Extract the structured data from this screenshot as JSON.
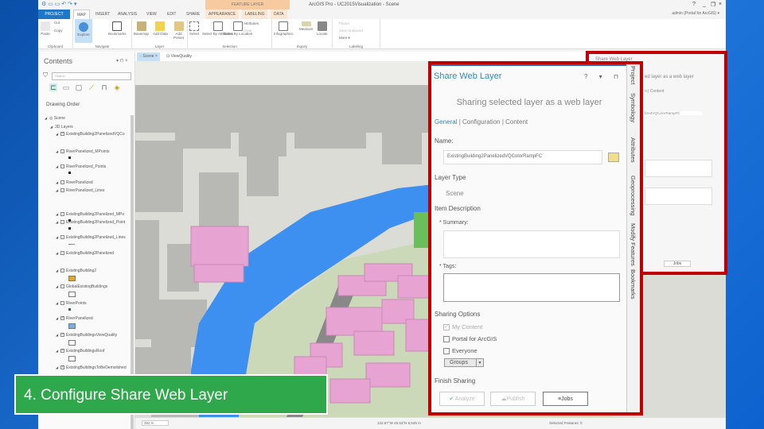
{
  "app": {
    "title": "ArcGIS Pro - UC2015Visualization - Scene",
    "contextual_tab": "FEATURE LAYER",
    "user": "admin (Portal for ArcGIS) ▾",
    "help": "?",
    "minimize": "_",
    "restore": "❐",
    "close": "×"
  },
  "ribbon_tabs": [
    "PROJECT",
    "MAP",
    "INSERT",
    "ANALYSIS",
    "VIEW",
    "EDIT",
    "SHARE",
    "APPEARANCE",
    "LABELING",
    "DATA"
  ],
  "ribbon_groups": [
    {
      "label": "Clipboard",
      "buttons": [
        "Paste",
        "Cut",
        "Copy"
      ]
    },
    {
      "label": "Navigate",
      "buttons": [
        "Explore",
        "Bookmarks"
      ]
    },
    {
      "label": "Layer",
      "buttons": [
        "Basemap",
        "Add Data",
        "Add Preset"
      ]
    },
    {
      "label": "Selection",
      "buttons": [
        "Select",
        "Select By Attributes",
        "Select By Location",
        "Attributes",
        "Clear"
      ]
    },
    {
      "label": "Inquiry",
      "buttons": [
        "Infographics",
        "Measure",
        "Locate"
      ]
    },
    {
      "label": "Labeling",
      "buttons": [
        "Pause",
        "View Unplaced",
        "More ▾"
      ]
    }
  ],
  "contents": {
    "title": "Contents",
    "pane_buttons": "▾ ⊓ ×",
    "search_placeholder": "Search",
    "drawing_order": "Drawing Order",
    "layers": [
      {
        "name": "Scene",
        "checked": null,
        "indent": 0,
        "symbol": "scene"
      },
      {
        "name": "3D Layers",
        "checked": null,
        "indent": 1,
        "symbol": "none"
      },
      {
        "name": "ExistingBuilding2PanelizedVQCo",
        "checked": true,
        "indent": 2,
        "symbol": "none"
      },
      {
        "name": "RiverPanelized_MPoints",
        "checked": false,
        "indent": 2,
        "symbol": "dot"
      },
      {
        "name": "RiverPanelized_Points",
        "checked": false,
        "indent": 2,
        "symbol": "dot"
      },
      {
        "name": "RiverPanelized",
        "checked": false,
        "indent": 2,
        "symbol": "none"
      },
      {
        "name": "RiverPanelized_Lines",
        "checked": false,
        "indent": 2,
        "symbol": "none"
      },
      {
        "name": "ExistingBuilding2Panelized_MPo",
        "checked": false,
        "indent": 2,
        "symbol": "dot"
      },
      {
        "name": "ExistingBuilding2Panelized_Point",
        "checked": false,
        "indent": 2,
        "symbol": "dot"
      },
      {
        "name": "ExistingBuilding2Panelized_Lines",
        "checked": false,
        "indent": 2,
        "symbol": "line"
      },
      {
        "name": "ExistingBuilding2Panelized",
        "checked": false,
        "indent": 2,
        "symbol": "none"
      },
      {
        "name": "ExistingBuilding2",
        "checked": false,
        "indent": 2,
        "symbol": "fill-orange"
      },
      {
        "name": "GlobalExistingBuildings",
        "checked": false,
        "indent": 2,
        "symbol": "fill-white"
      },
      {
        "name": "RiverPoints",
        "checked": false,
        "indent": 2,
        "symbol": "dot-green"
      },
      {
        "name": "RiverPanelized",
        "checked": true,
        "indent": 2,
        "symbol": "fill-blue"
      },
      {
        "name": "ExistingBuildingsViewQuality",
        "checked": true,
        "indent": 2,
        "symbol": "fill-white"
      },
      {
        "name": "ExistingBuildingsRoof",
        "checked": true,
        "indent": 2,
        "symbol": "fill-white"
      },
      {
        "name": "ExistingBuildingsToBeDemolished",
        "checked": true,
        "indent": 2,
        "symbol": "none"
      }
    ]
  },
  "map": {
    "tabs": [
      "Scene",
      "ViewQuality"
    ],
    "scale": "352 m",
    "coordinates": "122.67°W 45.53°N 5,545 m",
    "selected": "Selected Features: 0"
  },
  "share": {
    "title": "Share Web Layer",
    "controls": "? ▾ ⊓ ×",
    "subtitle": "Sharing selected layer as a web layer",
    "tabs": [
      "General",
      "Configuration",
      "Content"
    ],
    "active_tab": "General",
    "name_label": "Name:",
    "name_value": "ExistingBuilding2PanelizedVQColorRampFC",
    "layer_type_label": "Layer Type",
    "layer_type_value": "Scene",
    "item_description_label": "Item Description",
    "summary_label": "* Summary:",
    "summary_value": "",
    "tags_label": "* Tags:",
    "tags_value": "",
    "sharing_options_label": "Sharing Options",
    "options": [
      {
        "label": "My Content",
        "checked": true,
        "disabled": true
      },
      {
        "label": "Portal for ArcGIS",
        "checked": false
      },
      {
        "label": "Everyone",
        "checked": false
      }
    ],
    "groups_label": "Groups",
    "finish_label": "Finish Sharing",
    "analyze": "Analyze",
    "publish": "Publish",
    "jobs": "Jobs",
    "side_tabs": [
      "Project",
      "Symbology",
      "Attributes",
      "Geoprocessing",
      "Modify Features",
      "Bookmarks"
    ]
  },
  "background_panel": {
    "title": "Share Web Layer",
    "subtitle_partial": "ed layer as a web layer",
    "tabs_partial": "n | Content",
    "name_partial": "lizedVQColorRampFC",
    "jobs": "Jobs"
  },
  "caption": "4. Configure Share Web Layer",
  "colors": {
    "accent": "#2f8ab8",
    "highlight_border": "#c00000",
    "caption_bg": "#2ea84a",
    "river": "#3d8ff0",
    "building_selected": "#e7a4d3",
    "building": "#b8b8b4"
  }
}
